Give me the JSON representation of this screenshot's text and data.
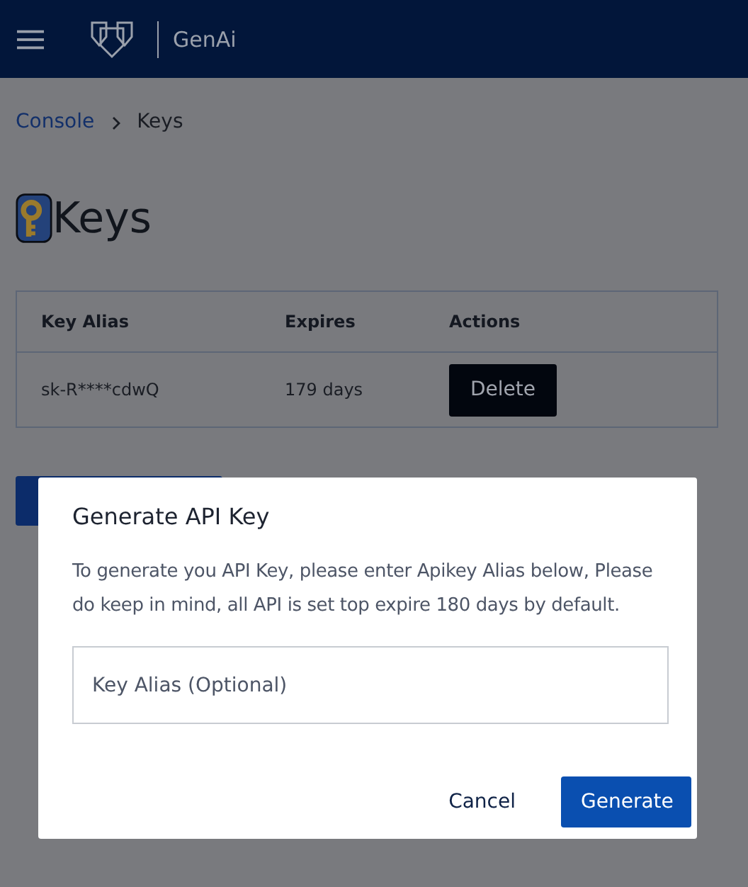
{
  "header": {
    "app_name": "GenAi"
  },
  "breadcrumb": [
    "Console",
    "Keys"
  ],
  "page_title": "Keys",
  "table": {
    "columns": [
      "Key Alias",
      "Expires",
      "Actions"
    ],
    "rows": [
      {
        "alias": "sk-R****cdwQ",
        "expires": "179 days",
        "action": "Delete"
      }
    ]
  },
  "dialog": {
    "title": "Generate API Key",
    "message": "To generate you API Key, please enter Apikey Alias below, Please do keep in mind, all API is set top expire 180 days by default.",
    "field": {
      "placeholder": "Key Alias (Optional)"
    },
    "buttons": [
      {
        "label": "Cancel",
        "kind": "text"
      },
      {
        "label": "Generate",
        "kind": "primary"
      }
    ]
  }
}
